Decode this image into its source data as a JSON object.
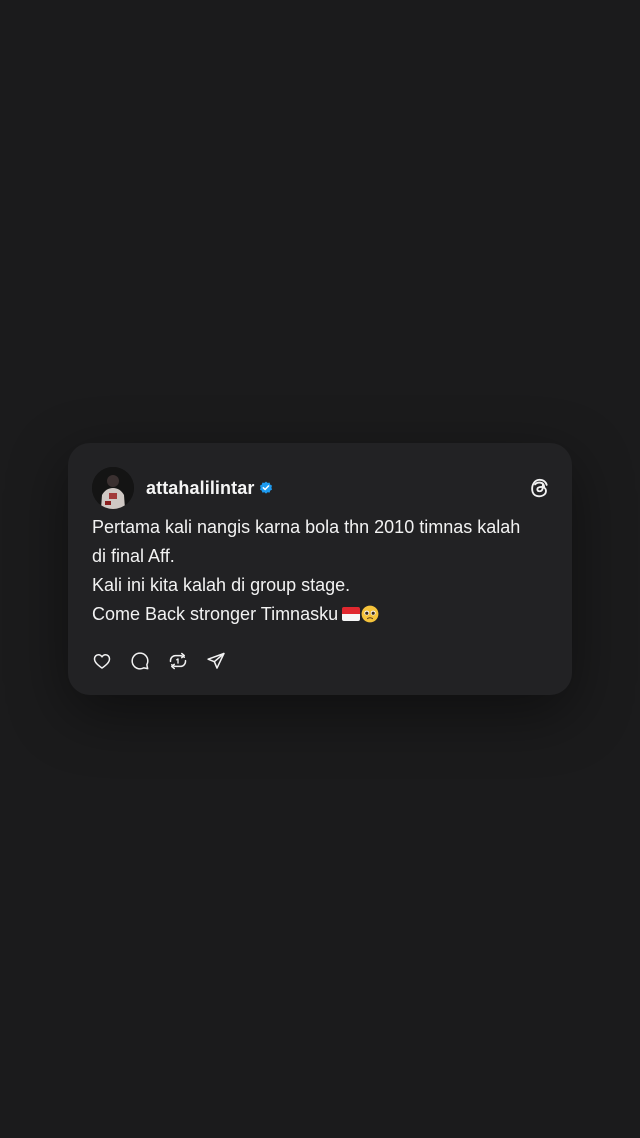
{
  "post": {
    "username": "attahalilintar",
    "verified": true,
    "lines": [
      "Pertama kali nangis karna bola thn 2010 timnas kalah",
      "di final Aff.",
      "Kali ini kita kalah di group stage.",
      "Come Back stronger Timnasku"
    ],
    "trailing_emojis": [
      "indonesia-flag",
      "pleading-face"
    ]
  },
  "icons": {
    "platform_logo": "threads-icon",
    "verified_badge": "verified-badge-icon",
    "actions": [
      "heart-icon",
      "comment-icon",
      "repost-icon",
      "share-icon"
    ]
  },
  "colors": {
    "background": "#1b1b1c",
    "card": "#222224",
    "text": "#f2f2f2",
    "verified": "#1d9bf0",
    "flag_red": "#e0282f",
    "flag_white": "#f6f6f6"
  }
}
